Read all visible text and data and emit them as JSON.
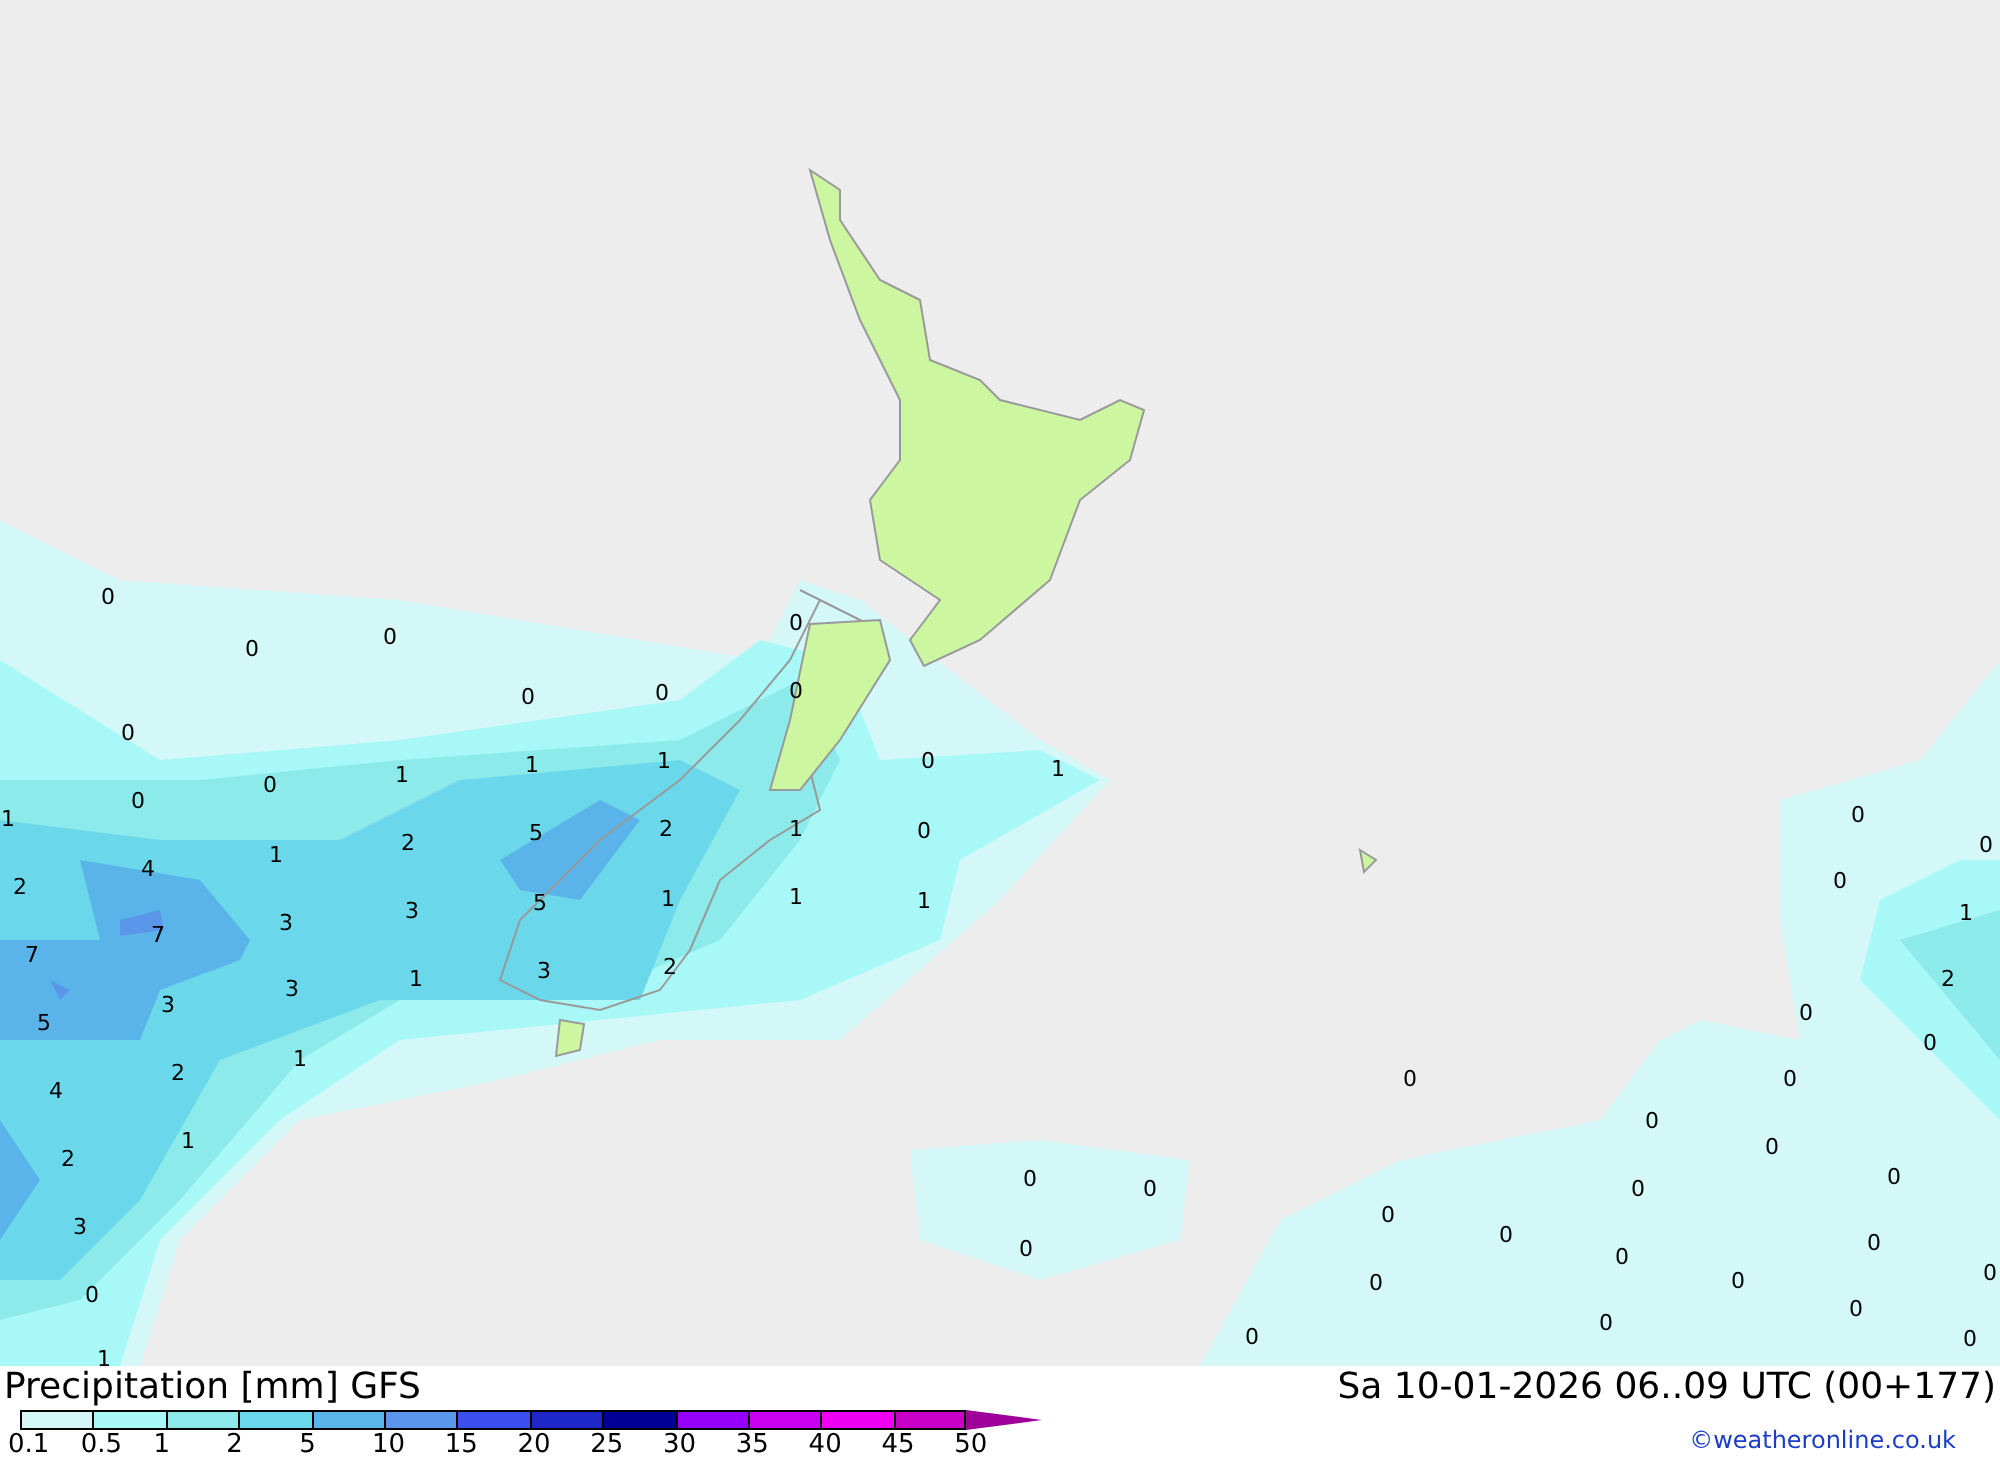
{
  "map_labels": [
    "0",
    "0",
    "0",
    "0",
    "0",
    "0",
    "0",
    "0",
    "0",
    "0",
    "1",
    "1",
    "1",
    "1",
    "2",
    "5",
    "2",
    "1",
    "0",
    "1",
    "0",
    "2",
    "4",
    "1",
    "3",
    "3",
    "5",
    "1",
    "1",
    "1",
    "7",
    "7",
    "3",
    "3",
    "1",
    "3",
    "2",
    "5",
    "2",
    "1",
    "4",
    "1",
    "2",
    "3",
    "0",
    "1",
    "0",
    "0",
    "0",
    "1",
    "2",
    "0",
    "0",
    "0",
    "0",
    "0",
    "0",
    "0",
    "0",
    "0",
    "0",
    "0",
    "0",
    "0",
    "0",
    "0",
    "0",
    "0",
    "0",
    "0",
    "0",
    "0",
    "0"
  ],
  "footer": {
    "title": "Precipitation [mm] GFS",
    "valid_time": "Sa 10-01-2026 06..09 UTC (00+177)",
    "copyright": "©weatheronline.co.uk"
  },
  "legend": [
    {
      "label": "0.1",
      "color": "#d4f8f8"
    },
    {
      "label": "0.5",
      "color": "#a8f8f8"
    },
    {
      "label": "1",
      "color": "#8ceaea"
    },
    {
      "label": "2",
      "color": "#6ad8ea"
    },
    {
      "label": "5",
      "color": "#5ab4ea"
    },
    {
      "label": "10",
      "color": "#5a96ea"
    },
    {
      "label": "15",
      "color": "#3c50f0"
    },
    {
      "label": "20",
      "color": "#1e28c8"
    },
    {
      "label": "25",
      "color": "#000096"
    },
    {
      "label": "30",
      "color": "#9600fa"
    },
    {
      "label": "35",
      "color": "#c800f0"
    },
    {
      "label": "40",
      "color": "#f000f0"
    },
    {
      "label": "45",
      "color": "#c800c8"
    },
    {
      "label": "50",
      "color": "#a0009a"
    }
  ]
}
